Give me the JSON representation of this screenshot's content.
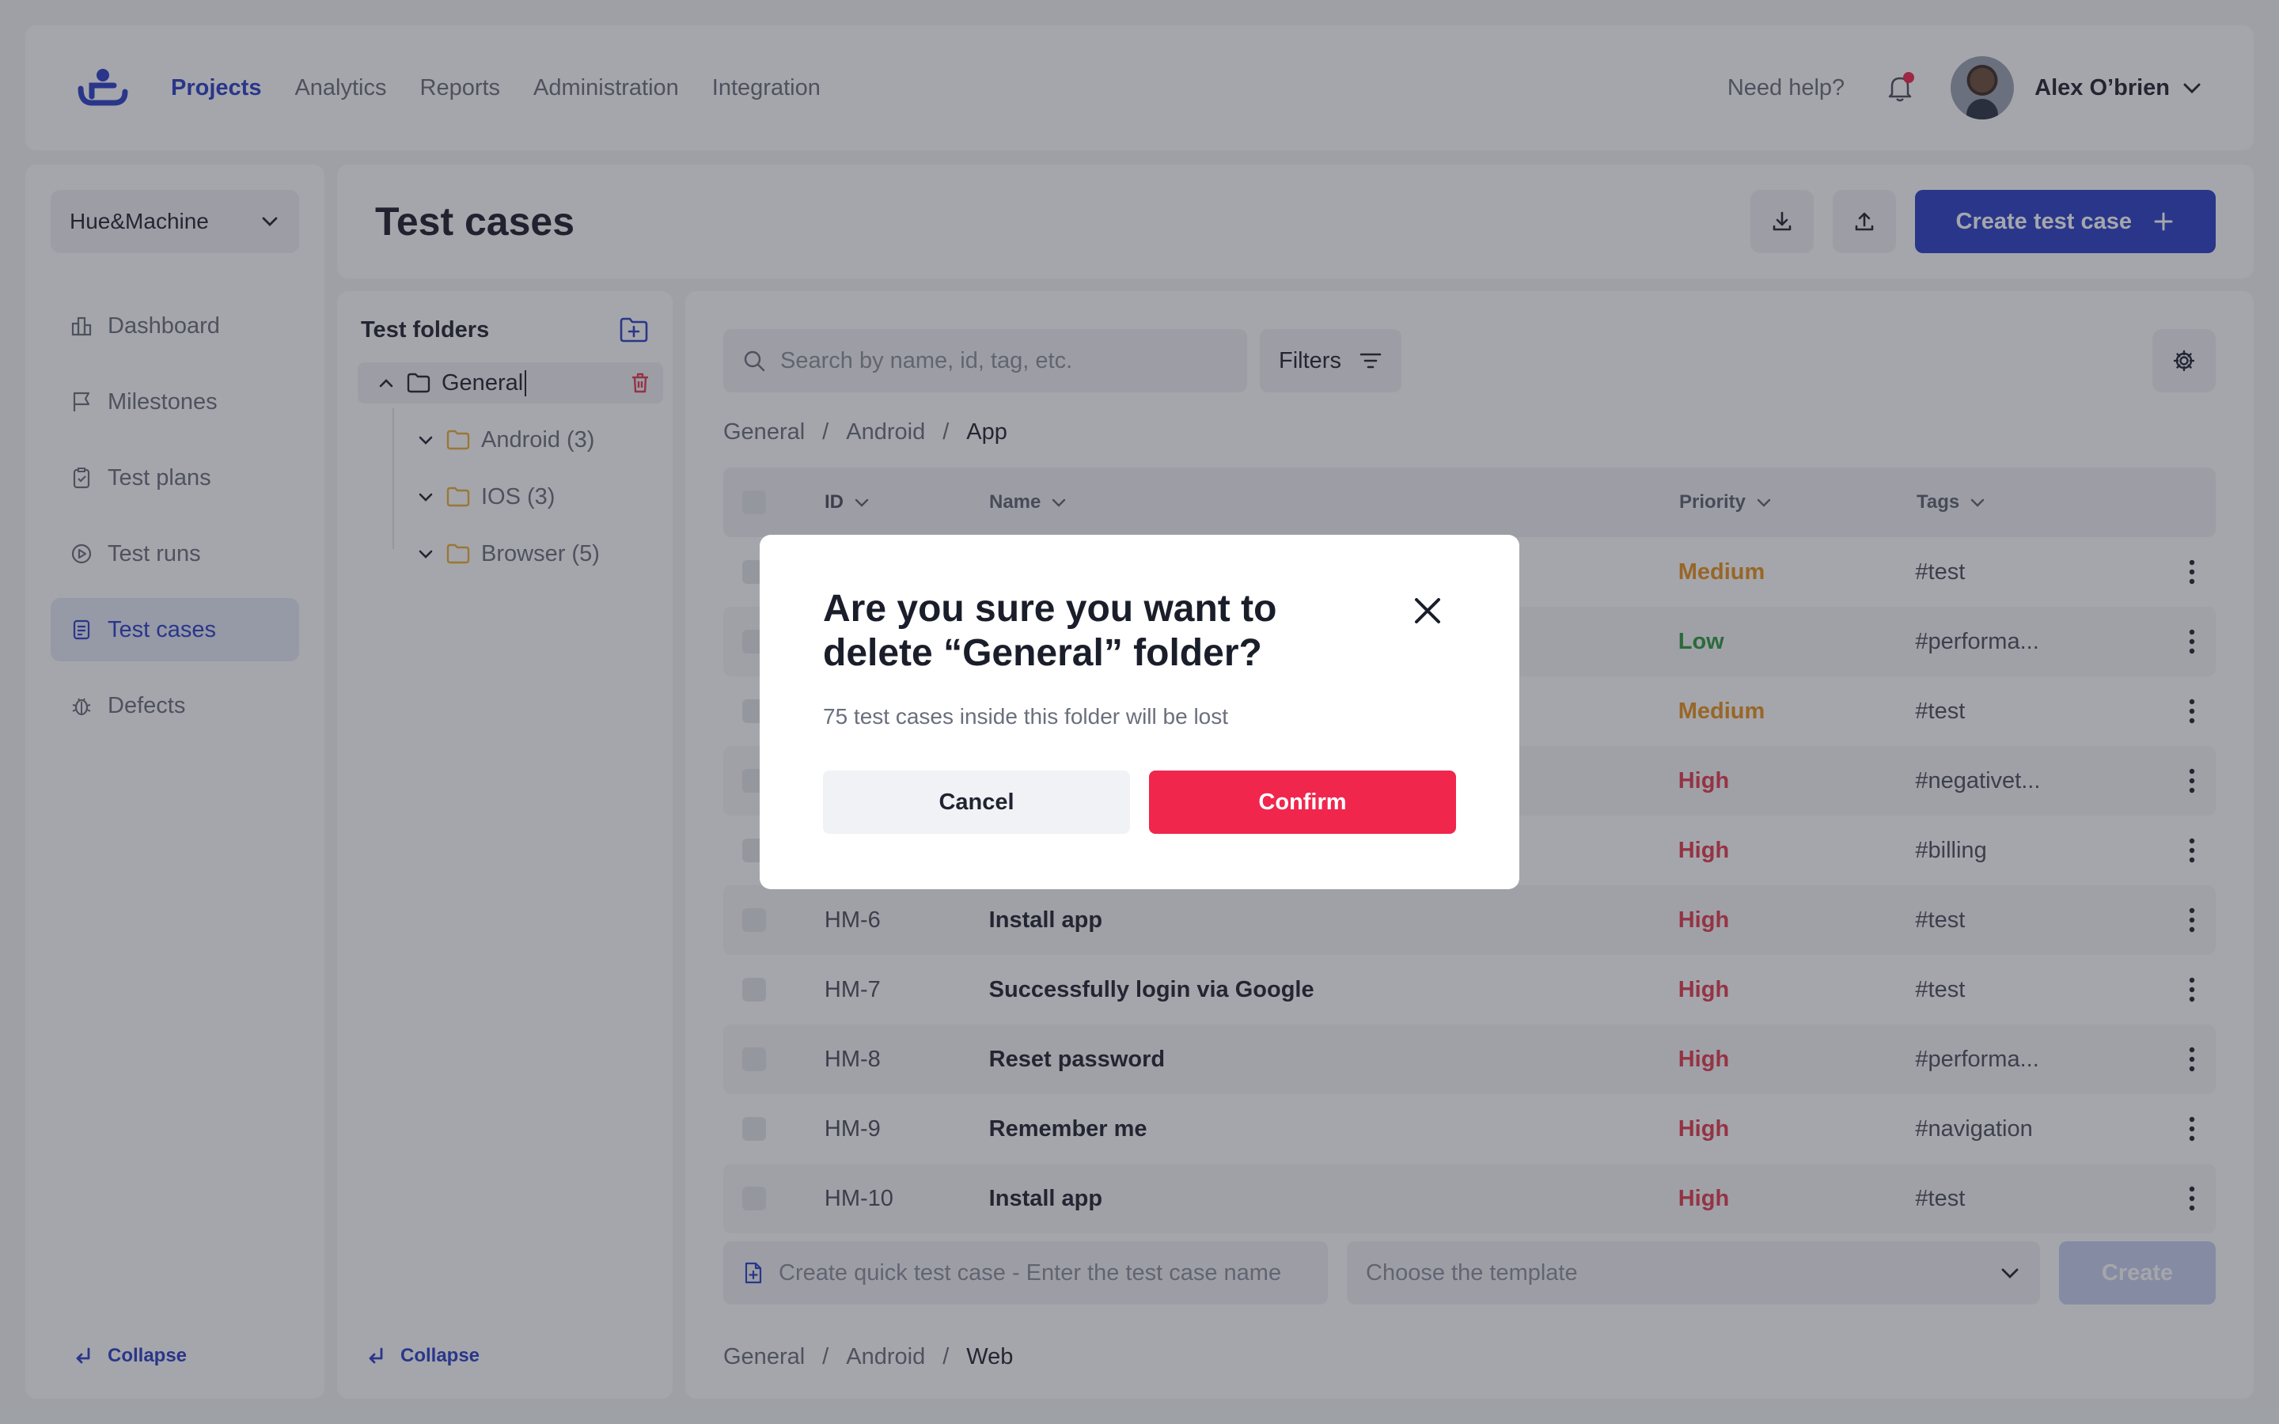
{
  "colors": {
    "accent": "#2a3ec6",
    "danger": "#f0264d",
    "priority_high": "#e23a4e",
    "priority_medium": "#e8921c",
    "priority_low": "#2b9a3e",
    "folder_icon": "#e8b03a"
  },
  "header": {
    "nav": [
      {
        "label": "Projects",
        "active": true
      },
      {
        "label": "Analytics",
        "active": false
      },
      {
        "label": "Reports",
        "active": false
      },
      {
        "label": "Administration",
        "active": false
      },
      {
        "label": "Integration",
        "active": false
      }
    ],
    "help_label": "Need help?",
    "user_name": "Alex O’brien"
  },
  "sidebar": {
    "project": "Hue&Machine",
    "items": [
      {
        "label": "Dashboard",
        "icon": "dashboard-icon"
      },
      {
        "label": "Milestones",
        "icon": "flag-icon"
      },
      {
        "label": "Test plans",
        "icon": "clipboard-icon"
      },
      {
        "label": "Test runs",
        "icon": "play-circle-icon"
      },
      {
        "label": "Test cases",
        "icon": "document-list-icon",
        "active": true
      },
      {
        "label": "Defects",
        "icon": "bug-icon"
      }
    ],
    "collapse_label": "Collapse"
  },
  "page": {
    "title": "Test cases",
    "create_label": "Create test case"
  },
  "folders": {
    "title": "Test folders",
    "root": "General",
    "children": [
      "Android (3)",
      "IOS (3)",
      "Browser (5)"
    ],
    "collapse_label": "Collapse"
  },
  "main": {
    "search_placeholder": "Search by name, id, tag, etc.",
    "filters_label": "Filters",
    "breadcrumb": [
      "General",
      "/",
      "Android",
      "/",
      "App"
    ],
    "columns": {
      "id": "ID",
      "name": "Name",
      "priority": "Priority",
      "tags": "Tags"
    },
    "rows": [
      {
        "id": "",
        "name": "",
        "priority": "Medium",
        "level": "medium",
        "tag": "#test"
      },
      {
        "id": "",
        "name": "",
        "priority": "Low",
        "level": "low",
        "tag": "#performa..."
      },
      {
        "id": "",
        "name": "",
        "priority": "Medium",
        "level": "medium",
        "tag": "#test"
      },
      {
        "id": "",
        "name": "",
        "priority": "High",
        "level": "high",
        "tag": "#negativet..."
      },
      {
        "id": "",
        "name": "",
        "priority": "High",
        "level": "high",
        "tag": "#billing"
      },
      {
        "id": "HM-6",
        "name": "Install app",
        "priority": "High",
        "level": "high",
        "tag": "#test"
      },
      {
        "id": "HM-7",
        "name": "Successfully login via Google",
        "priority": "High",
        "level": "high",
        "tag": "#test"
      },
      {
        "id": "HM-8",
        "name": "Reset password",
        "priority": "High",
        "level": "high",
        "tag": "#performa..."
      },
      {
        "id": "HM-9",
        "name": "Remember me",
        "priority": "High",
        "level": "high",
        "tag": "#navigation"
      },
      {
        "id": "HM-10",
        "name": "Install app",
        "priority": "High",
        "level": "high",
        "tag": "#test"
      }
    ],
    "quick_placeholder": "Create quick test case - Enter the test case name",
    "template_placeholder": "Choose the template",
    "create_label": "Create",
    "breadcrumb2": [
      "General",
      "/",
      "Android",
      "/",
      "Web"
    ]
  },
  "modal": {
    "title": "Are you sure you want to delete “General” folder?",
    "text": "75 test cases inside this folder will be lost",
    "cancel_label": "Cancel",
    "confirm_label": "Confirm"
  }
}
